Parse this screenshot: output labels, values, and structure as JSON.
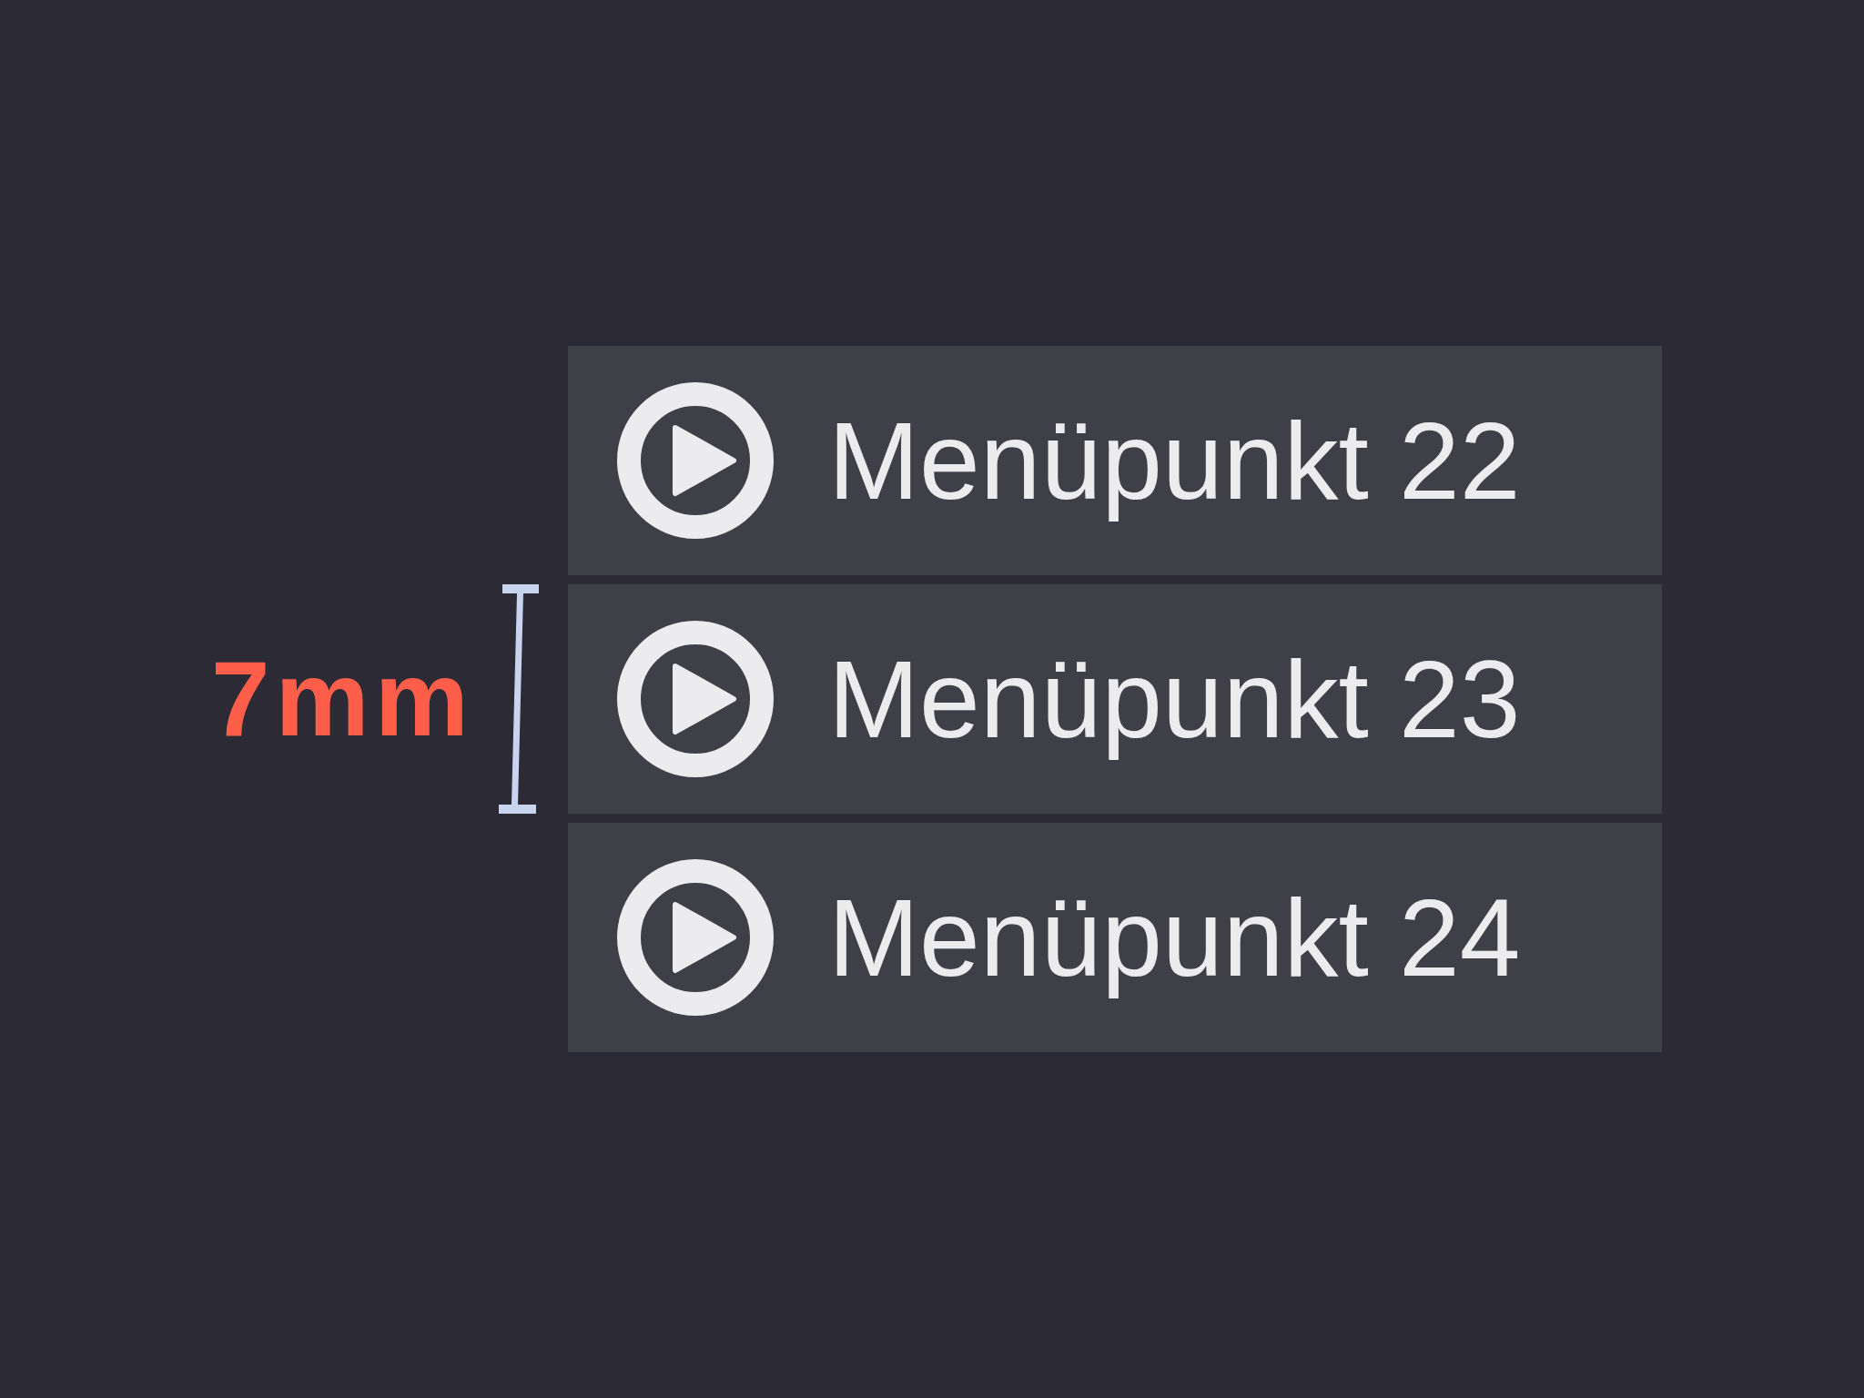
{
  "annotation": {
    "label": "7mm"
  },
  "menu_items": [
    {
      "label": "Menüpunkt 22",
      "measured": false
    },
    {
      "label": "Menüpunkt 23",
      "measured": true
    },
    {
      "label": "Menüpunkt 24",
      "measured": false
    }
  ]
}
